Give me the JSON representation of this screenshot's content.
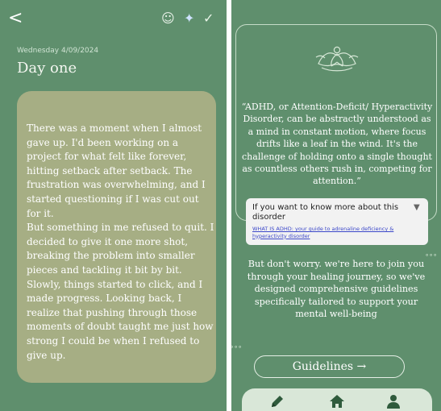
{
  "journal": {
    "date": "Wednesday 4/09/2024",
    "title": "Day one",
    "entry_text": "There was a moment when I almost gave up. I'd been working on a project for what felt like forever, hitting setback after setback. The frustration was overwhelming, and I started questioning if I was cut out for it.\nBut something in me refused to quit. I decided to give it one more shot, breaking the problem into smaller pieces and tackling it bit by bit. Slowly, things started to click, and I made progress. Looking back, I realize that pushing through those moments of doubt taught me just how strong I could be when I refused to give up."
  },
  "toolbar": {
    "back_glyph": "<",
    "mood_glyph": "☺",
    "sparkle_glyph": "✦",
    "check_glyph": "✓"
  },
  "info_panel": {
    "quote": "“ADHD, or Attention-Deficit/ Hyperactivity Disorder, can be abstractly understood as a mind in constant motion, where focus drifts like a leaf in the wind. It's the challenge of holding onto a single thought as countless others rush in, competing for attention.”",
    "expander_title": "If you want to know more about this disorder",
    "expander_arrow": "▼",
    "link_text": "WHAT IS ADHD: your guide to adrenaline deficiency & hyperactivity disorder",
    "support_text": "But don't worry. we're here to join you through your healing journey, so we've designed comprehensive guidelines specifically tailored to support your mental well-being",
    "guidelines_label": "Guidelines →"
  },
  "icons": {
    "lotus": "lotus-meditation-icon",
    "nav_edit": "pencil-icon",
    "nav_home": "home-icon",
    "nav_profile": "person-icon"
  },
  "colors": {
    "panel_green": "#5f8f6d",
    "entry_card": "#a6ae84",
    "nav_bar": "#d9e7d8",
    "link_blue": "#3b47c9"
  }
}
